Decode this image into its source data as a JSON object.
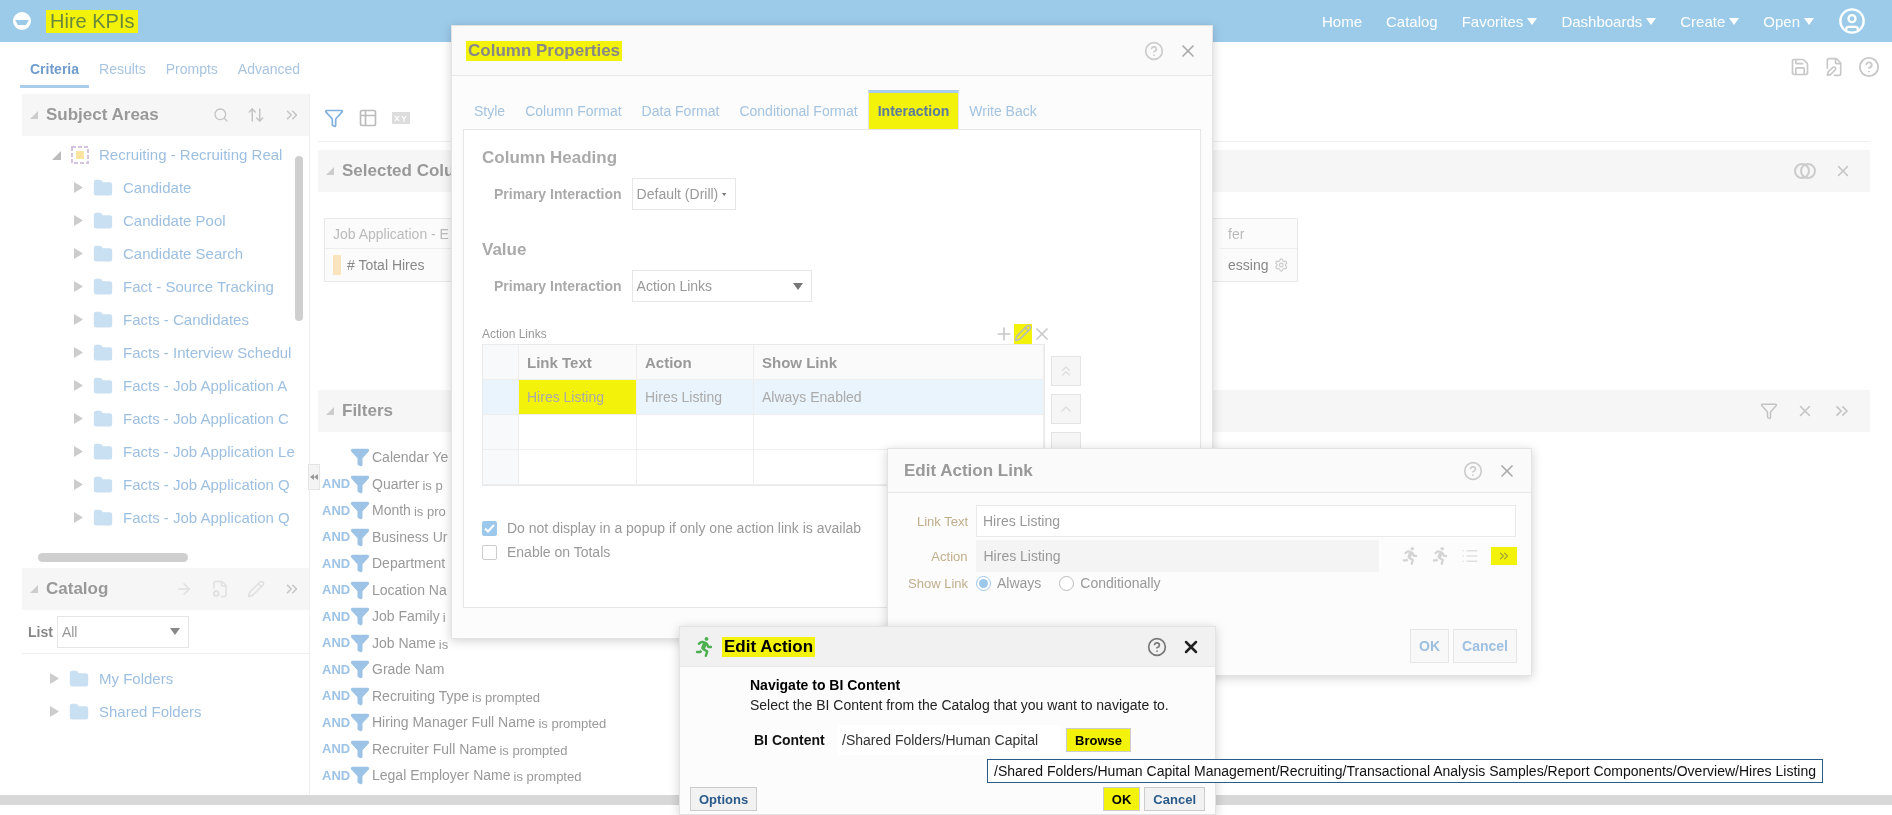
{
  "app_bar": {
    "title": "Hire KPIs",
    "title_highlighted": true,
    "nav": [
      {
        "label": "Home",
        "menu": false
      },
      {
        "label": "Catalog",
        "menu": false
      },
      {
        "label": "Favorites",
        "menu": true
      },
      {
        "label": "Dashboards",
        "menu": true
      },
      {
        "label": "Create",
        "menu": true
      },
      {
        "label": "Open",
        "menu": true
      }
    ]
  },
  "editor_tabs": [
    {
      "label": "Criteria",
      "selected": true
    },
    {
      "label": "Results",
      "selected": false
    },
    {
      "label": "Prompts",
      "selected": false
    },
    {
      "label": "Advanced",
      "selected": false
    }
  ],
  "subject_areas": {
    "title": "Subject Areas",
    "root": {
      "label": "Recruiting - Recruiting Real",
      "expanded": true,
      "children": [
        {
          "label": "Candidate",
          "expanded": false
        },
        {
          "label": "Candidate Pool",
          "expanded": false
        },
        {
          "label": "Candidate Search",
          "expanded": false
        },
        {
          "label": "Fact - Source Tracking",
          "expanded": false
        },
        {
          "label": "Facts - Candidates",
          "expanded": false
        },
        {
          "label": "Facts - Interview Schedul",
          "expanded": false
        },
        {
          "label": "Facts - Job Application A",
          "expanded": false
        },
        {
          "label": "Facts - Job Application C",
          "expanded": false
        },
        {
          "label": "Facts - Job Application Le",
          "expanded": false
        },
        {
          "label": "Facts - Job Application Q",
          "expanded": false
        },
        {
          "label": "Facts - Job Application Q",
          "expanded": false
        }
      ]
    }
  },
  "catalog": {
    "title": "Catalog",
    "list_label": "List",
    "list_value": "All",
    "folders": [
      {
        "label": "My Folders",
        "expanded": false
      },
      {
        "label": "Shared Folders",
        "expanded": false
      }
    ]
  },
  "selected_columns": {
    "title": "Selected Colu",
    "columns": [
      {
        "folder": "Job Application - E",
        "name": "# Total Hires"
      },
      {
        "folder": "fer",
        "name": "essing"
      }
    ]
  },
  "filters": {
    "title": "Filters",
    "items": [
      {
        "name": "Calendar Ye"
      },
      {
        "conjunction": "AND",
        "name": "Quarter",
        "suffix": "is p"
      },
      {
        "conjunction": "AND",
        "name": "Month",
        "suffix": "is pro"
      },
      {
        "conjunction": "AND",
        "name": "Business Ur"
      },
      {
        "conjunction": "AND",
        "name": "Department"
      },
      {
        "conjunction": "AND",
        "name": "Location Na"
      },
      {
        "conjunction": "AND",
        "name": "Job Family",
        "suffix": "i"
      },
      {
        "conjunction": "AND",
        "name": "Job Name",
        "suffix": "is"
      },
      {
        "conjunction": "AND",
        "name": "Grade Nam"
      },
      {
        "conjunction": "AND",
        "name": "Recruiting Type",
        "suffix": "is prompted"
      },
      {
        "conjunction": "AND",
        "name": "Hiring Manager Full Name",
        "suffix": "is prompted"
      },
      {
        "conjunction": "AND",
        "name": "Recruiter Full Name",
        "suffix": "is prompted"
      },
      {
        "conjunction": "AND",
        "name": "Legal Employer Name",
        "suffix": "is prompted"
      }
    ]
  },
  "column_properties": {
    "title": "Column Properties",
    "title_highlighted": true,
    "tabs": [
      {
        "label": "Style",
        "selected": false,
        "highlighted": false
      },
      {
        "label": "Column Format",
        "selected": false,
        "highlighted": false
      },
      {
        "label": "Data Format",
        "selected": false,
        "highlighted": false
      },
      {
        "label": "Conditional Format",
        "selected": false,
        "highlighted": false
      },
      {
        "label": "Interaction",
        "selected": true,
        "highlighted": true
      },
      {
        "label": "Write Back",
        "selected": false,
        "highlighted": false
      }
    ],
    "column_heading": {
      "title": "Column Heading",
      "interaction_label": "Primary Interaction",
      "interaction_value": "Default (Drill)"
    },
    "value": {
      "title": "Value",
      "interaction_label": "Primary Interaction",
      "interaction_value": "Action Links"
    },
    "action_links": {
      "label": "Action Links",
      "edit_highlighted": true,
      "columns": [
        "Link Text",
        "Action",
        "Show Link"
      ],
      "rows": [
        {
          "cells": [
            "Hires Listing",
            "Hires Listing",
            "Always Enabled"
          ],
          "selected": true,
          "highlighted": true
        }
      ]
    },
    "options": [
      {
        "label": "Do not display in a popup if only one action link is availab",
        "checked": true
      },
      {
        "label": "Enable on Totals",
        "checked": false
      }
    ]
  },
  "edit_action_link": {
    "title": "Edit Action Link",
    "link_text_label": "Link Text",
    "link_text": "Hires Listing",
    "action_label": "Action",
    "action_value": "Hires Listing",
    "more_highlighted": true,
    "show_link_label": "Show Link",
    "show_link_options": [
      {
        "label": "Always",
        "selected": true
      },
      {
        "label": "Conditionally",
        "selected": false
      }
    ],
    "buttons": [
      "OK",
      "Cancel"
    ]
  },
  "edit_action": {
    "title": "Edit Action",
    "title_highlighted": true,
    "heading": "Navigate to BI Content",
    "instruction": "Select the BI Content from the Catalog that you want to navigate to.",
    "content_label": "BI Content",
    "content_path": "/Shared Folders/Human Capital",
    "browse": {
      "label": "Browse",
      "highlighted": true
    },
    "buttons": [
      {
        "label": "Options",
        "highlighted": false
      },
      {
        "label": "OK",
        "highlighted": true
      },
      {
        "label": "Cancel",
        "highlighted": false
      }
    ]
  },
  "tooltip": "/Shared Folders/Human Capital Management/Recruiting/Transactional Analysis Samples/Report Components/Overview/Hires Listing"
}
